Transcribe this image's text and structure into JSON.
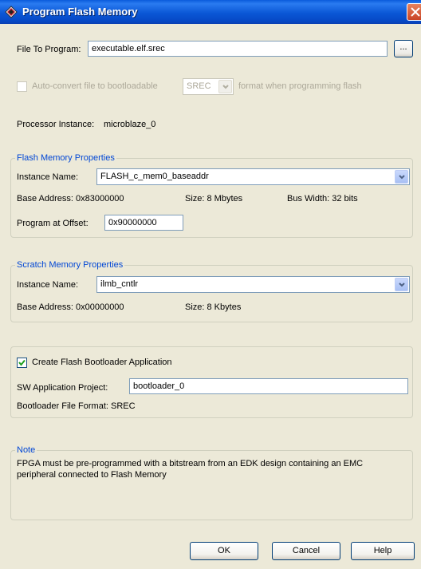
{
  "window": {
    "title": "Program Flash Memory"
  },
  "file": {
    "label": "File To Program:",
    "value": "executable.elf.srec",
    "browse_label": "..."
  },
  "autoconvert": {
    "label": "Auto-convert file to bootloadable",
    "format_value": "SREC",
    "suffix": "format when programming flash",
    "checked": false,
    "enabled": false
  },
  "processor": {
    "label": "Processor Instance:",
    "value": "microblaze_0"
  },
  "flash": {
    "group_title": "Flash Memory Properties",
    "instance_label": "Instance Name:",
    "instance_value": "FLASH_c_mem0_baseaddr",
    "base_address": "Base Address:  0x83000000",
    "size": "Size:  8 Mbytes",
    "bus_width": "Bus Width:  32 bits",
    "offset_label": "Program at Offset:",
    "offset_value": "0x90000000"
  },
  "scratch": {
    "group_title": "Scratch Memory Properties",
    "instance_label": "Instance Name:",
    "instance_value": "ilmb_cntlr",
    "base_address": "Base Address:  0x00000000",
    "size": "Size:  8 Kbytes"
  },
  "bootloader": {
    "checkbox_label": "Create Flash Bootloader Application",
    "checked": true,
    "project_label": "SW Application Project:",
    "project_value": "bootloader_0",
    "format_label": "Bootloader File Format:  SREC"
  },
  "note": {
    "group_title": "Note",
    "line1": "FPGA must be pre-programmed with a bitstream from an EDK design containing an EMC",
    "line2": "peripheral connected to Flash Memory"
  },
  "buttons": {
    "ok": "OK",
    "cancel": "Cancel",
    "help": "Help"
  },
  "colors": {
    "titlebar": "#0a57d6",
    "dialog_bg": "#ece9d8",
    "group_title": "#0046d5",
    "close_button": "#d9572f"
  }
}
